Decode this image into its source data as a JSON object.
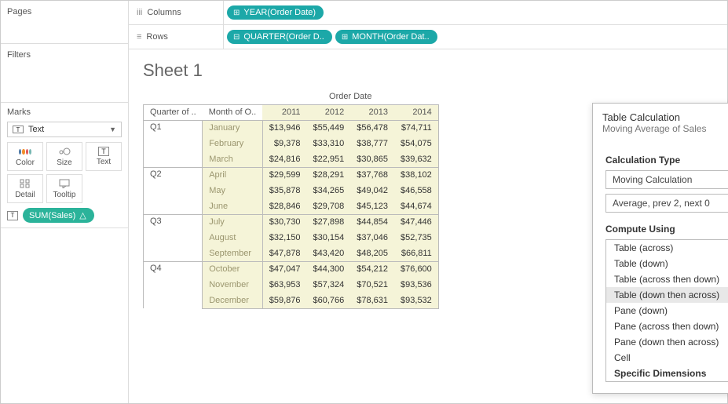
{
  "panels": {
    "pages": "Pages",
    "filters": "Filters",
    "marks": "Marks"
  },
  "marks_card": {
    "dropdown_icon": "T",
    "dropdown_label": "Text",
    "cells": {
      "color": "Color",
      "size": "Size",
      "text": "Text",
      "detail": "Detail",
      "tooltip": "Tooltip"
    },
    "pill_icon": "T",
    "pill_label": "SUM(Sales)",
    "pill_warn": "△"
  },
  "shelves": {
    "columns_label": "Columns",
    "rows_label": "Rows",
    "columns_pills": [
      {
        "prefix": "⊞",
        "label": "YEAR(Order Date)"
      }
    ],
    "rows_pills": [
      {
        "prefix": "⊟",
        "label": "QUARTER(Order D.."
      },
      {
        "prefix": "⊞",
        "label": "MONTH(Order Dat.."
      }
    ]
  },
  "sheet": {
    "title": "Sheet 1",
    "super_header": "Order Date",
    "row_headers": [
      "Quarter of ..",
      "Month of O.."
    ],
    "year_headers": [
      "2011",
      "2012",
      "2013",
      "2014"
    ],
    "rows": [
      {
        "quarter": "Q1",
        "month": "January",
        "values": [
          "$13,946",
          "$55,449",
          "$56,478",
          "$74,711"
        ]
      },
      {
        "quarter": "",
        "month": "February",
        "values": [
          "$9,378",
          "$33,310",
          "$38,777",
          "$54,075"
        ]
      },
      {
        "quarter": "",
        "month": "March",
        "values": [
          "$24,816",
          "$22,951",
          "$30,865",
          "$39,632"
        ]
      },
      {
        "quarter": "Q2",
        "month": "April",
        "values": [
          "$29,599",
          "$28,291",
          "$37,768",
          "$38,102"
        ]
      },
      {
        "quarter": "",
        "month": "May",
        "values": [
          "$35,878",
          "$34,265",
          "$49,042",
          "$46,558"
        ]
      },
      {
        "quarter": "",
        "month": "June",
        "values": [
          "$28,846",
          "$29,708",
          "$45,123",
          "$44,674"
        ]
      },
      {
        "quarter": "Q3",
        "month": "July",
        "values": [
          "$30,730",
          "$27,898",
          "$44,854",
          "$47,446"
        ]
      },
      {
        "quarter": "",
        "month": "August",
        "values": [
          "$32,150",
          "$30,154",
          "$37,046",
          "$52,735"
        ]
      },
      {
        "quarter": "",
        "month": "September",
        "values": [
          "$47,878",
          "$43,420",
          "$48,205",
          "$66,811"
        ]
      },
      {
        "quarter": "Q4",
        "month": "October",
        "values": [
          "$47,047",
          "$44,300",
          "$54,212",
          "$76,600"
        ]
      },
      {
        "quarter": "",
        "month": "November",
        "values": [
          "$63,953",
          "$57,324",
          "$70,521",
          "$93,536"
        ]
      },
      {
        "quarter": "",
        "month": "December",
        "values": [
          "$59,876",
          "$60,766",
          "$78,631",
          "$93,532"
        ]
      }
    ]
  },
  "dialog": {
    "title": "Table Calculation",
    "subtitle": "Moving Average of Sales",
    "calc_type_label": "Calculation Type",
    "calc_type_value": "Moving Calculation",
    "calc_avg_value": "Average, prev 2, next 0",
    "compute_label": "Compute Using",
    "compute_options": [
      "Table (across)",
      "Table (down)",
      "Table (across then down)",
      "Table (down then across)",
      "Pane (down)",
      "Pane (across then down)",
      "Pane (down then across)",
      "Cell",
      "Specific Dimensions"
    ],
    "compute_selected_index": 3
  }
}
